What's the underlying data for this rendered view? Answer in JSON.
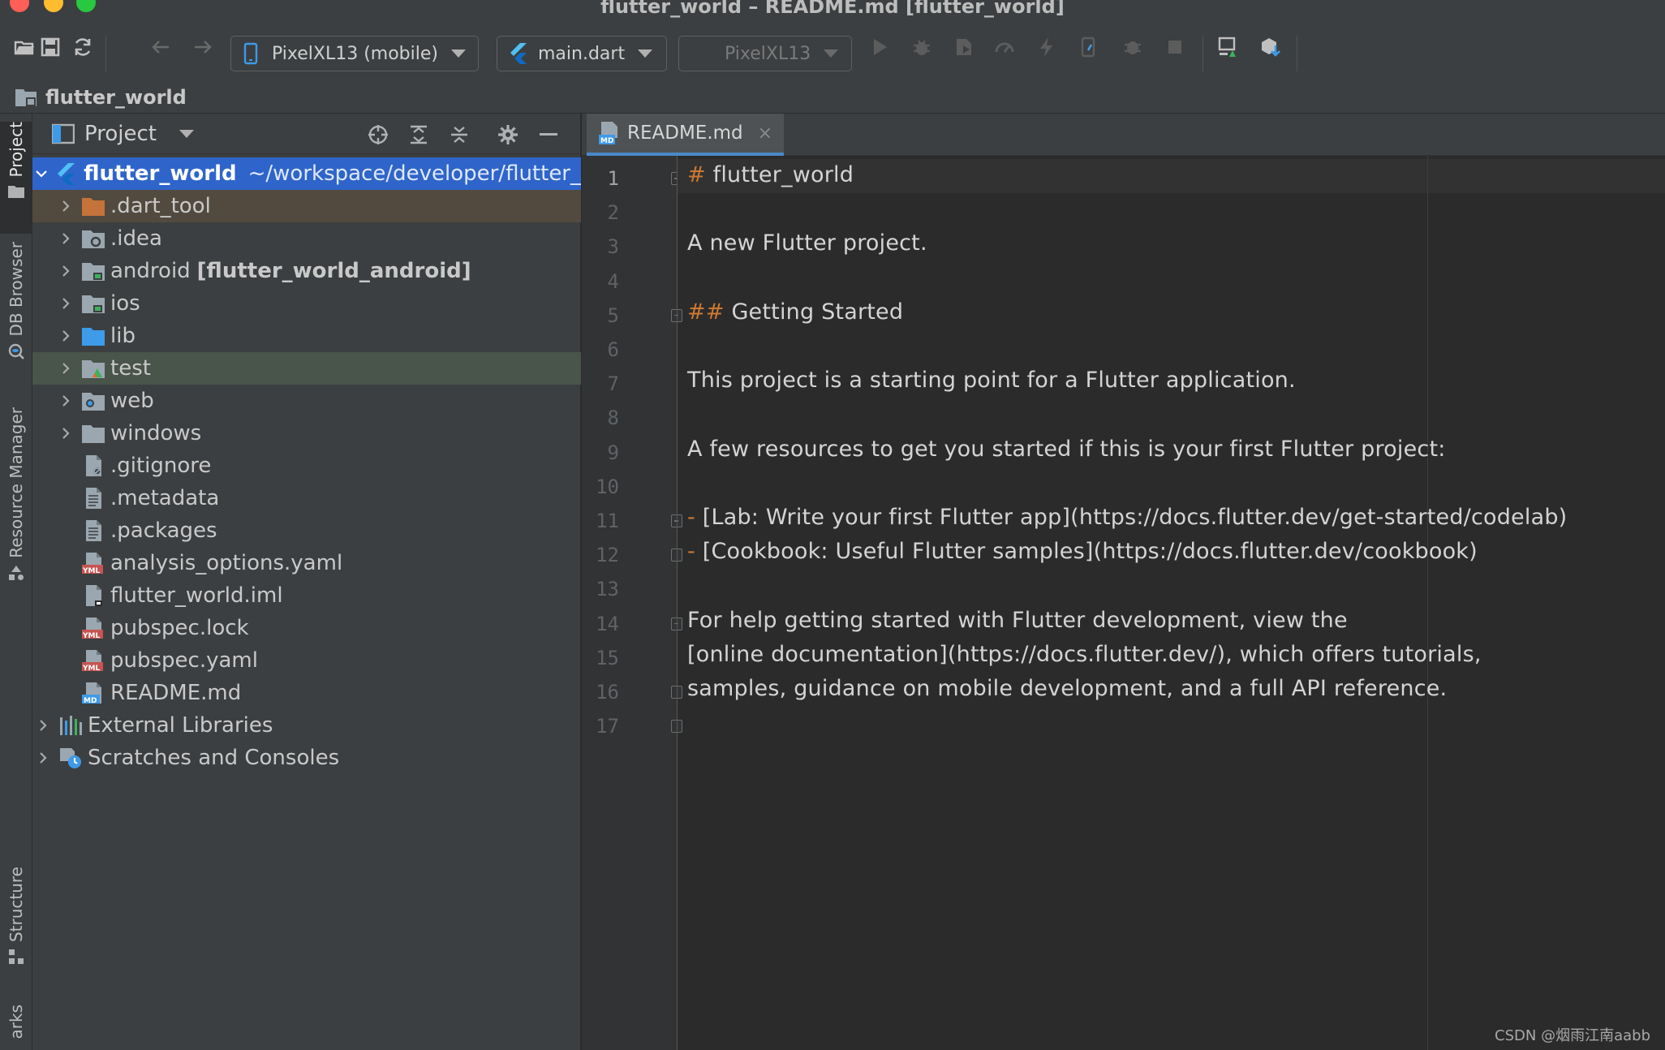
{
  "window": {
    "title": "flutter_world – README.md [flutter_world]"
  },
  "toolbar": {
    "device_selector": "PixelXL13 (mobile)",
    "run_config": "main.dart",
    "target_device": "PixelXL13"
  },
  "breadcrumb": {
    "project": "flutter_world"
  },
  "left_strip": {
    "tabs": [
      "Project",
      "DB Browser",
      "Resource Manager",
      "Structure",
      "arks"
    ]
  },
  "project_panel": {
    "title": "Project",
    "tree": [
      {
        "name": "flutter_world",
        "hint": "~/workspace/developer/flutter_",
        "depth": 0,
        "expandable": true,
        "expanded": true,
        "icon": "flutter-project-icon",
        "state": "selected"
      },
      {
        "name": ".dart_tool",
        "depth": 1,
        "expandable": true,
        "icon": "folder-excluded-icon",
        "state": "excluded"
      },
      {
        "name": ".idea",
        "depth": 1,
        "expandable": true,
        "icon": "folder-settings-icon"
      },
      {
        "name": "android",
        "suffix": "[flutter_world_android]",
        "depth": 1,
        "expandable": true,
        "icon": "folder-module-icon"
      },
      {
        "name": "ios",
        "depth": 1,
        "expandable": true,
        "icon": "folder-module-icon"
      },
      {
        "name": "lib",
        "depth": 1,
        "expandable": true,
        "icon": "folder-source-icon"
      },
      {
        "name": "test",
        "depth": 1,
        "expandable": true,
        "icon": "folder-test-icon",
        "state": "tested"
      },
      {
        "name": "web",
        "depth": 1,
        "expandable": true,
        "icon": "folder-web-icon"
      },
      {
        "name": "windows",
        "depth": 1,
        "expandable": true,
        "icon": "folder-icon"
      },
      {
        "name": ".gitignore",
        "depth": 1,
        "expandable": false,
        "icon": "ignore-file-icon"
      },
      {
        "name": ".metadata",
        "depth": 1,
        "expandable": false,
        "icon": "text-file-icon"
      },
      {
        "name": ".packages",
        "depth": 1,
        "expandable": false,
        "icon": "text-file-icon"
      },
      {
        "name": "analysis_options.yaml",
        "depth": 1,
        "expandable": false,
        "icon": "yaml-file-icon"
      },
      {
        "name": "flutter_world.iml",
        "depth": 1,
        "expandable": false,
        "icon": "iml-file-icon"
      },
      {
        "name": "pubspec.lock",
        "depth": 1,
        "expandable": false,
        "icon": "yaml-file-icon"
      },
      {
        "name": "pubspec.yaml",
        "depth": 1,
        "expandable": false,
        "icon": "yaml-file-icon"
      },
      {
        "name": "README.md",
        "depth": 1,
        "expandable": false,
        "icon": "markdown-file-icon"
      },
      {
        "name": "External Libraries",
        "depth": 0,
        "expandable": true,
        "icon": "libraries-icon"
      },
      {
        "name": "Scratches and Consoles",
        "depth": 0,
        "expandable": true,
        "icon": "scratches-icon"
      }
    ]
  },
  "editor": {
    "tab_label": "README.md",
    "tab_close": "×",
    "lines": [
      {
        "n": "1",
        "marker": "#",
        "text": " flutter_world",
        "fold": "open"
      },
      {
        "n": "2",
        "text": ""
      },
      {
        "n": "3",
        "text": "A new Flutter project."
      },
      {
        "n": "4",
        "text": ""
      },
      {
        "n": "5",
        "marker": "##",
        "text": " Getting Started",
        "fold": "open"
      },
      {
        "n": "6",
        "text": ""
      },
      {
        "n": "7",
        "text": "This project is a starting point for a Flutter application."
      },
      {
        "n": "8",
        "text": ""
      },
      {
        "n": "9",
        "text": "A few resources to get you started if this is your first Flutter project:"
      },
      {
        "n": "10",
        "text": ""
      },
      {
        "n": "11",
        "marker": "-",
        "text": " [Lab: Write your first Flutter app](https://docs.flutter.dev/get-started/codelab)",
        "fold": "open"
      },
      {
        "n": "12",
        "marker": "-",
        "text": " [Cookbook: Useful Flutter samples](https://docs.flutter.dev/cookbook)",
        "fold": "close"
      },
      {
        "n": "13",
        "text": ""
      },
      {
        "n": "14",
        "text": "For help getting started with Flutter development, view the",
        "fold": "open"
      },
      {
        "n": "15",
        "text": "[online documentation](https://docs.flutter.dev/), which offers tutorials,"
      },
      {
        "n": "16",
        "text": "samples, guidance on mobile development, and a full API reference.",
        "fold": "close"
      },
      {
        "n": "17",
        "text": "",
        "fold": "close"
      }
    ]
  },
  "watermark": "CSDN @烟雨江南aabb",
  "colors": {
    "selection": "#2f65ca",
    "markdown_marker": "#cc7832",
    "panel_bg": "#3c3f41",
    "editor_bg": "#2b2b2b"
  }
}
